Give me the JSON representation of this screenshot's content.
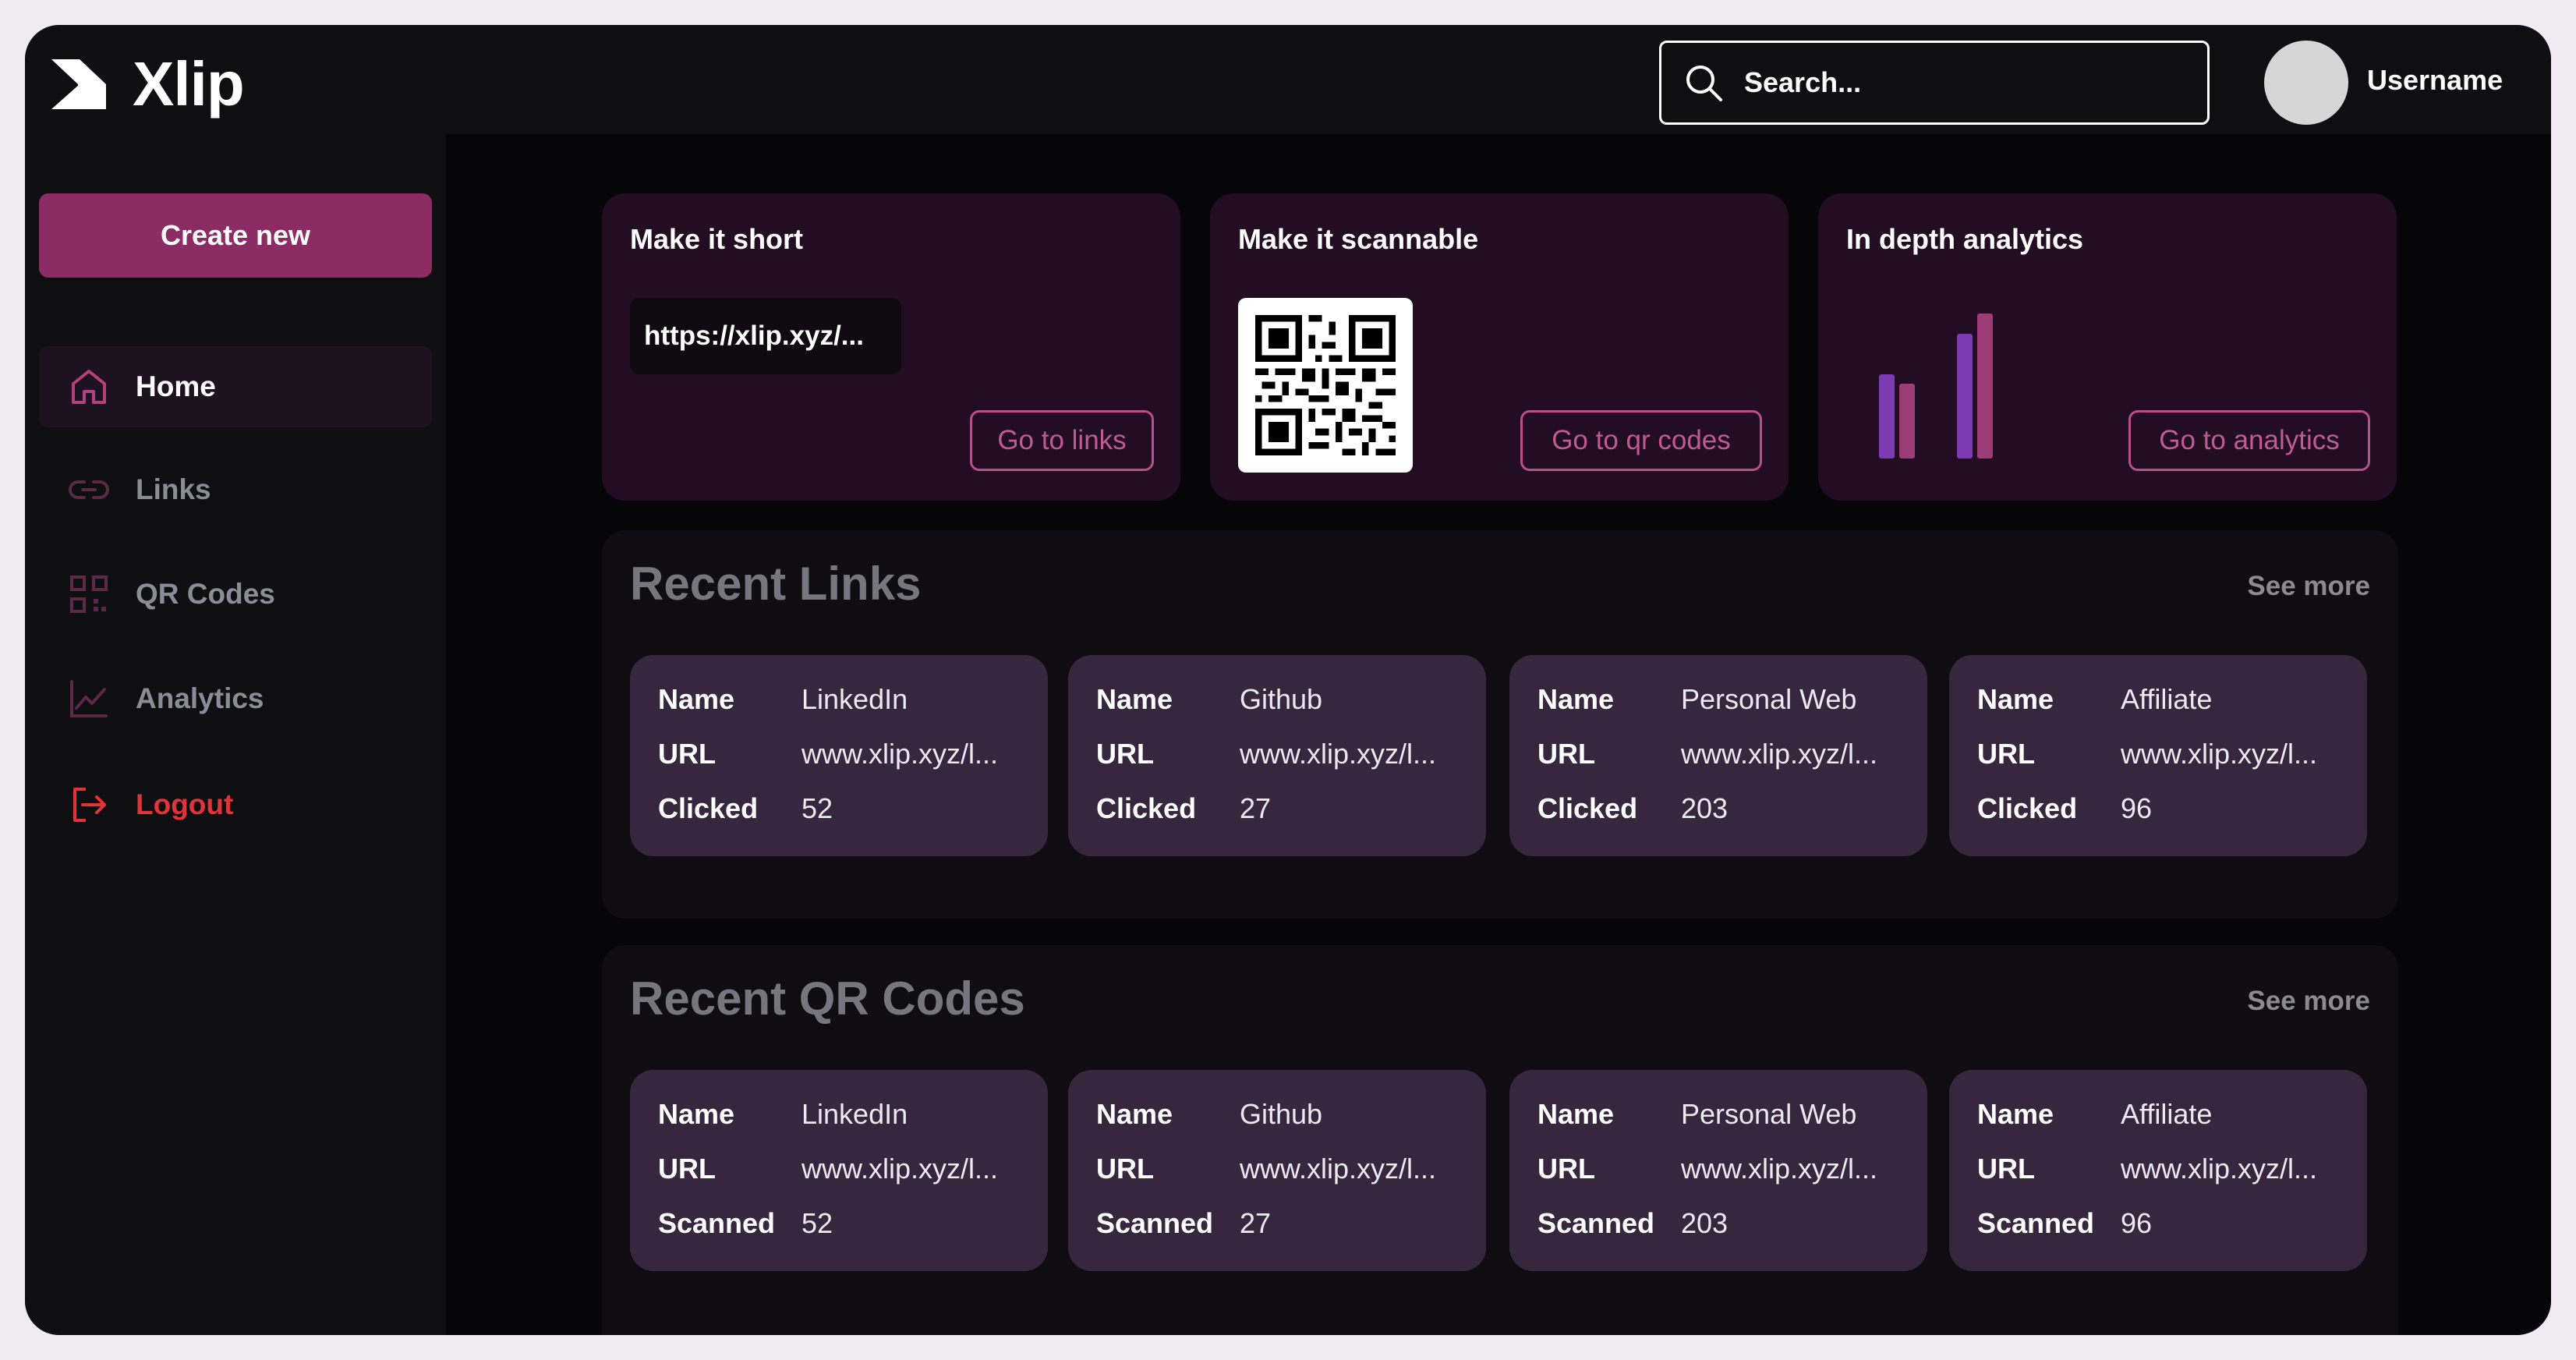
{
  "app": {
    "name": "Xlip"
  },
  "header": {
    "search_placeholder": "Search...",
    "username": "Username"
  },
  "sidebar": {
    "create_label": "Create new",
    "items": [
      {
        "label": "Home",
        "icon": "home-icon",
        "active": true
      },
      {
        "label": "Links",
        "icon": "link-icon"
      },
      {
        "label": "QR Codes",
        "icon": "qr-code-icon"
      },
      {
        "label": "Analytics",
        "icon": "analytics-icon"
      },
      {
        "label": "Logout",
        "icon": "logout-icon"
      }
    ]
  },
  "features": [
    {
      "title": "Make it short",
      "sample": "https://xlip.xyz/...",
      "button": "Go to links"
    },
    {
      "title": "Make it scannable",
      "button": "Go to qr codes"
    },
    {
      "title": "In depth analytics",
      "button": "Go to analytics"
    }
  ],
  "recent_links": {
    "title": "Recent Links",
    "see_more": "See more",
    "labels": {
      "name": "Name",
      "url": "URL",
      "count": "Clicked"
    },
    "items": [
      {
        "name": "LinkedIn",
        "url": "www.xlip.xyz/l...",
        "count": "52"
      },
      {
        "name": "Github",
        "url": "www.xlip.xyz/l...",
        "count": "27"
      },
      {
        "name": "Personal Web",
        "url": "www.xlip.xyz/l...",
        "count": "203"
      },
      {
        "name": "Affiliate",
        "url": "www.xlip.xyz/l...",
        "count": "96"
      }
    ]
  },
  "recent_qr": {
    "title": "Recent QR Codes",
    "see_more": "See more",
    "labels": {
      "name": "Name",
      "url": "URL",
      "count": "Scanned"
    },
    "items": [
      {
        "name": "LinkedIn",
        "url": "www.xlip.xyz/l...",
        "count": "52"
      },
      {
        "name": "Github",
        "url": "www.xlip.xyz/l...",
        "count": "27"
      },
      {
        "name": "Personal Web",
        "url": "www.xlip.xyz/l...",
        "count": "203"
      },
      {
        "name": "Affiliate",
        "url": "www.xlip.xyz/l...",
        "count": "96"
      }
    ]
  },
  "colors": {
    "accent": "#8c2c65",
    "outline": "#b94f8a",
    "card": "#37273e",
    "feature_bg": "#220d22",
    "logout": "#e2333a",
    "bar_purple": "#7a3bb3",
    "bar_pink": "#9c3d78"
  }
}
